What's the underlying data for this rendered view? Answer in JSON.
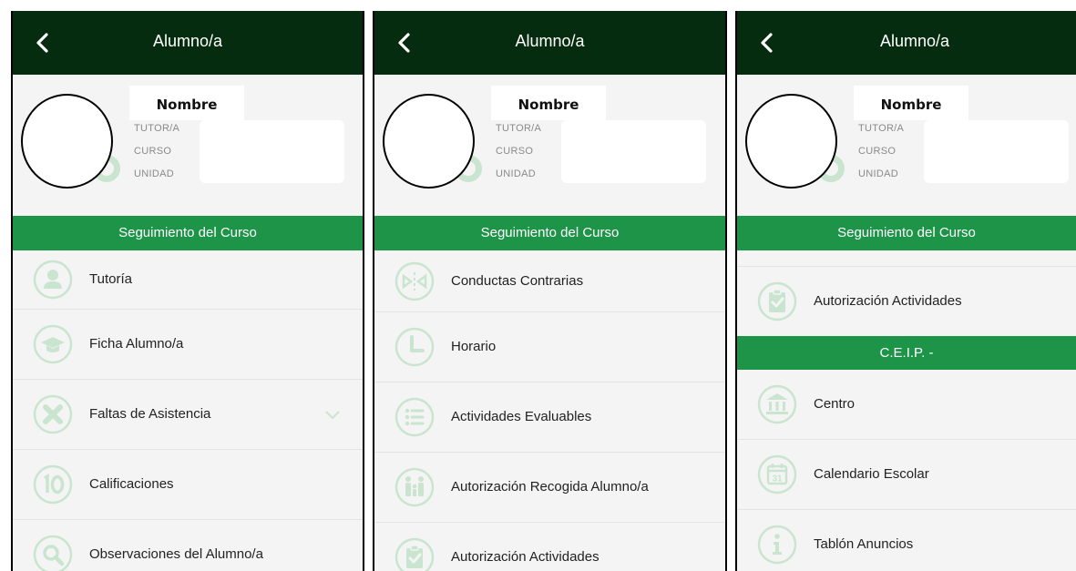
{
  "app_title": "Alumno/a",
  "profile": {
    "name": "Nombre",
    "labels": {
      "tutor": "TUTOR/A",
      "curso": "CURSO",
      "unidad": "UNIDAD"
    }
  },
  "sections": {
    "seguimiento": "Seguimiento del Curso",
    "centro": "C.E.I.P. -"
  },
  "panel1": {
    "items": [
      {
        "label": "Tutoría",
        "icon": "user-icon"
      },
      {
        "label": "Ficha Alumno/a",
        "icon": "graduation-cap-icon"
      },
      {
        "label": "Faltas de Asistencia",
        "icon": "cross-icon"
      },
      {
        "label": "Calificaciones",
        "icon": "number-ten-icon"
      },
      {
        "label": "Observaciones del Alumno/a",
        "icon": "magnifier-icon"
      }
    ]
  },
  "panel2": {
    "items": [
      {
        "label": "Conductas Contrarias",
        "icon": "conduct-icon"
      },
      {
        "label": "Horario",
        "icon": "clock-icon"
      },
      {
        "label": "Actividades Evaluables",
        "icon": "list-icon"
      },
      {
        "label": "Autorización Recogida Alumno/a",
        "icon": "family-icon"
      },
      {
        "label": "Autorización Actividades",
        "icon": "clipboard-check-icon"
      }
    ]
  },
  "panel3": {
    "items": [
      {
        "label": "Autorización Actividades",
        "icon": "clipboard-check-icon"
      },
      {
        "label": "Centro",
        "icon": "building-icon"
      },
      {
        "label": "Calendario Escolar",
        "icon": "calendar-icon"
      },
      {
        "label": "Tablón Anuncios",
        "icon": "info-icon"
      }
    ],
    "calendar_day": "31"
  },
  "colors": {
    "appbar": "#062c10",
    "accent": "#1e9448",
    "icon": "#c9e5cf"
  }
}
